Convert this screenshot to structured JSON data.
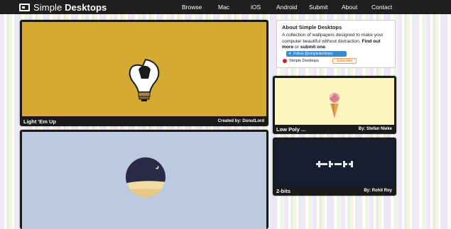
{
  "header": {
    "logo_light": "Simple",
    "logo_bold": "Desktops",
    "nav": [
      "Browse",
      "Mac",
      "iOS",
      "Android",
      "Submit",
      "About",
      "Contact"
    ]
  },
  "wallpapers": [
    {
      "title": "Light 'Em Up",
      "credit": "Created by: DonutLord",
      "bg": "#d5aa32"
    },
    {
      "title": "",
      "credit": "",
      "bg": "#bccadf"
    },
    {
      "title": "Low Poly ...",
      "credit": "By: Stefan Nieke",
      "bg": "#fdf4c0"
    },
    {
      "title": "2-bits",
      "credit": "By: Rohit Roy",
      "bg": "#171e30"
    }
  ],
  "about": {
    "title": "About Simple Desktops",
    "text": "A collection of wallpapers designed to make your computer beautiful without distraction.",
    "find_more": "Find out more",
    "or": "or",
    "submit_one": "submit one",
    "follow_label": "Follow @simpledesktops",
    "pin_label": "Simple Desktops",
    "subscribe_label": "Subscribe"
  },
  "colors": {
    "header_bg": "#1f1f1f",
    "card_bg": "#1a1a1a",
    "follow_blue": "#3a8bd2",
    "pin_red": "#c8232c"
  }
}
